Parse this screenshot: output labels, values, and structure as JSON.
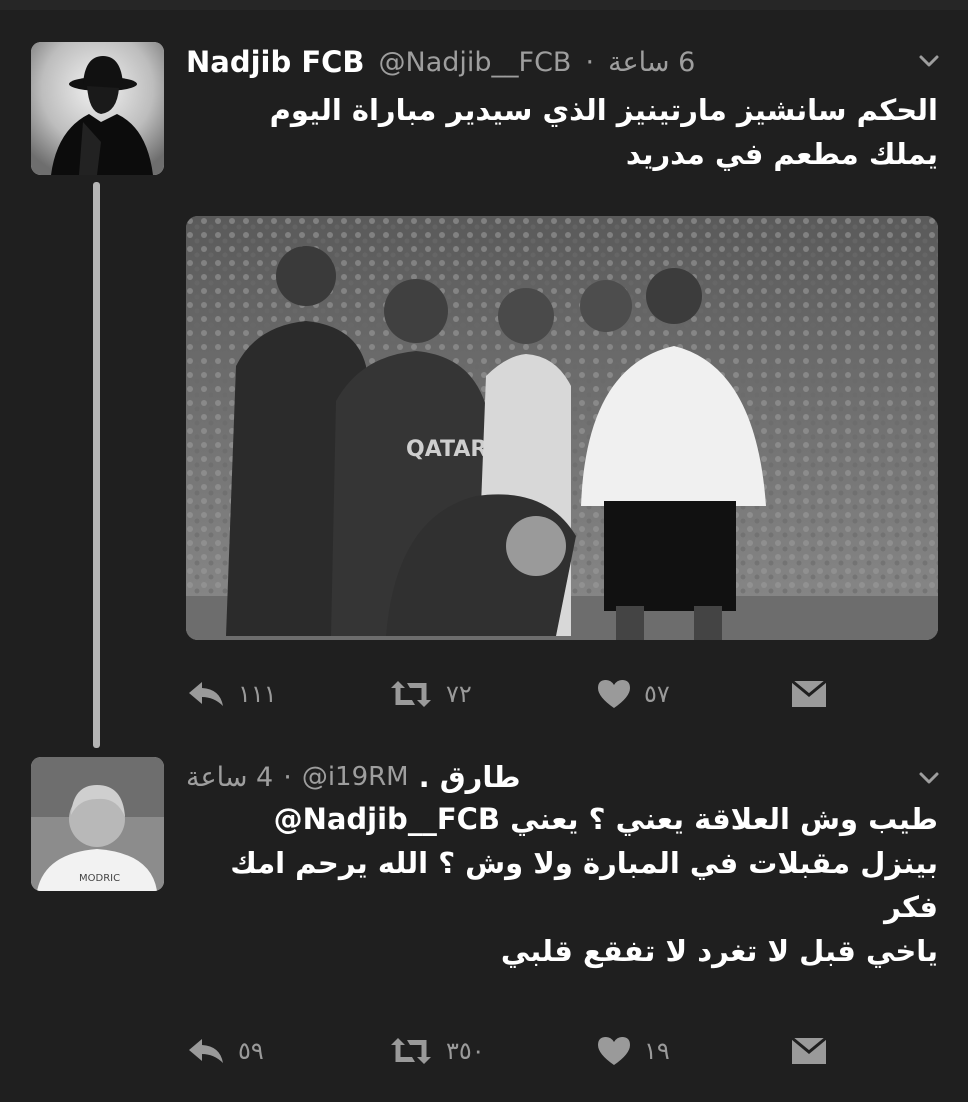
{
  "tweets": [
    {
      "display_name": "Nadjib FCB",
      "handle": "@Nadjib__FCB",
      "timestamp": "6 ساعة",
      "separator": "·",
      "text_lines": [
        "الحكم سانشيز مارتينيز الذي سيدير مباراة اليوم",
        "يملك مطعم في مدريد"
      ],
      "media_description": "football-match-referee-photo",
      "actions": {
        "reply_count": "١١١",
        "retweet_count": "٧٢",
        "like_count": "٥٧"
      }
    },
    {
      "display_name": "طارق .",
      "handle": "@i19RM",
      "timestamp": "4 ساعة",
      "separator": "·",
      "mention": "@Nadjib__FCB",
      "text_line_1_rest": "طيب وش العلاقة يعني ؟ يعني",
      "text_lines": [
        "بينزل مقبلات في المبارة ولا وش ؟ الله يرحم امك",
        "فكر",
        "ياخي قبل لا تغرد لا تفقع قلبي"
      ],
      "actions": {
        "reply_count": "٥٩",
        "retweet_count": "٣٥٠",
        "like_count": "١٩"
      }
    }
  ],
  "colors": {
    "background": "#1f1f1f",
    "text": "#ffffff",
    "secondary_text": "#9e9e9e",
    "icon": "#9a9a9a",
    "thread_line": "#b5b5b5"
  },
  "icons": {
    "reply": "reply-arrow-icon",
    "retweet": "retweet-icon",
    "like": "heart-icon",
    "message": "envelope-icon",
    "menu": "chevron-down-icon"
  }
}
